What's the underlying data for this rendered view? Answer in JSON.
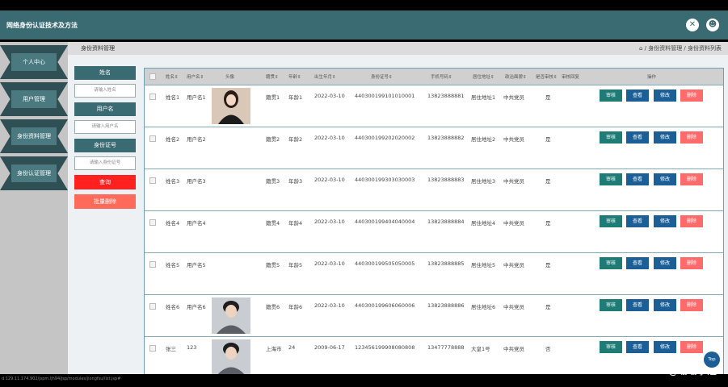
{
  "header": {
    "title": "网络身份认证技术及方法",
    "close_icon": "✕",
    "user_icon": "☻"
  },
  "sidebar": {
    "items": [
      {
        "label": "个人中心"
      },
      {
        "label": "用户管理"
      },
      {
        "label": "身份资料管理"
      },
      {
        "label": "身份认证管理"
      }
    ]
  },
  "page": {
    "title": "身份资料管理",
    "breadcrumb": "⌂ / 身份资料管理 / 身份资料列表"
  },
  "search": {
    "name_label": "姓名",
    "name_placeholder": "请输入姓名",
    "user_label": "用户名",
    "user_placeholder": "请输入用户名",
    "id_label": "身份证号",
    "id_placeholder": "请输入身份证号",
    "search_button": "查询",
    "batch_delete_button": "批量删除"
  },
  "table": {
    "columns": [
      "姓名⇕",
      "用户名⇕",
      "头像",
      "籍贯⇕",
      "年龄⇕",
      "出生年月⇕",
      "身份证号⇕",
      "手机号码⇕",
      "居住地址⇕",
      "政治面貌⇕",
      "是否审核⇕",
      "审核回复",
      "操作"
    ],
    "rows": [
      {
        "name": "姓名1",
        "user": "用户名1",
        "photo": "f",
        "native": "籍贯1",
        "age": "年龄1",
        "birth": "2022-03-10",
        "id": "440300199101010001",
        "phone": "13823888881",
        "addr": "居住地址1",
        "pol": "中共党员",
        "audit": "是"
      },
      {
        "name": "姓名2",
        "user": "用户名2",
        "photo": "",
        "native": "籍贯2",
        "age": "年龄2",
        "birth": "2022-03-10",
        "id": "440300199202020002",
        "phone": "13823888882",
        "addr": "居住地址2",
        "pol": "中共党员",
        "audit": "是"
      },
      {
        "name": "姓名3",
        "user": "用户名3",
        "photo": "",
        "native": "籍贯3",
        "age": "年龄3",
        "birth": "2022-03-10",
        "id": "440300199303030003",
        "phone": "13823888883",
        "addr": "居住地址3",
        "pol": "中共党员",
        "audit": "是"
      },
      {
        "name": "姓名4",
        "user": "用户名4",
        "photo": "",
        "native": "籍贯4",
        "age": "年龄4",
        "birth": "2022-03-10",
        "id": "440300199404040004",
        "phone": "13823888884",
        "addr": "居住地址4",
        "pol": "中共党员",
        "audit": "是"
      },
      {
        "name": "姓名5",
        "user": "用户名5",
        "photo": "",
        "native": "籍贯5",
        "age": "年龄5",
        "birth": "2022-03-10",
        "id": "440300199505050005",
        "phone": "13823888885",
        "addr": "居住地址5",
        "pol": "中共党员",
        "audit": "是"
      },
      {
        "name": "姓名6",
        "user": "用户名6",
        "photo": "m",
        "native": "籍贯6",
        "age": "年龄6",
        "birth": "2022-03-10",
        "id": "440300199606060006",
        "phone": "13823888886",
        "addr": "居住地址6",
        "pol": "中共党员",
        "audit": "是"
      },
      {
        "name": "张三",
        "user": "123",
        "photo": "m",
        "native": "上海市",
        "age": "24",
        "birth": "2009-06-17",
        "id": "123456199908080808",
        "phone": "13477778888",
        "addr": "大皇1号",
        "pol": "中共党员",
        "audit": "否"
      }
    ],
    "actions": {
      "audit": "审核",
      "view": "查看",
      "edit": "修改",
      "delete": "删除"
    }
  },
  "status_url": "d 129.11.174.902/jspm.ljh94/jsp/modules/jiongfsu/list.jsp#",
  "watermark": "CSDN @珊珊学姐",
  "top_button": "Top"
}
